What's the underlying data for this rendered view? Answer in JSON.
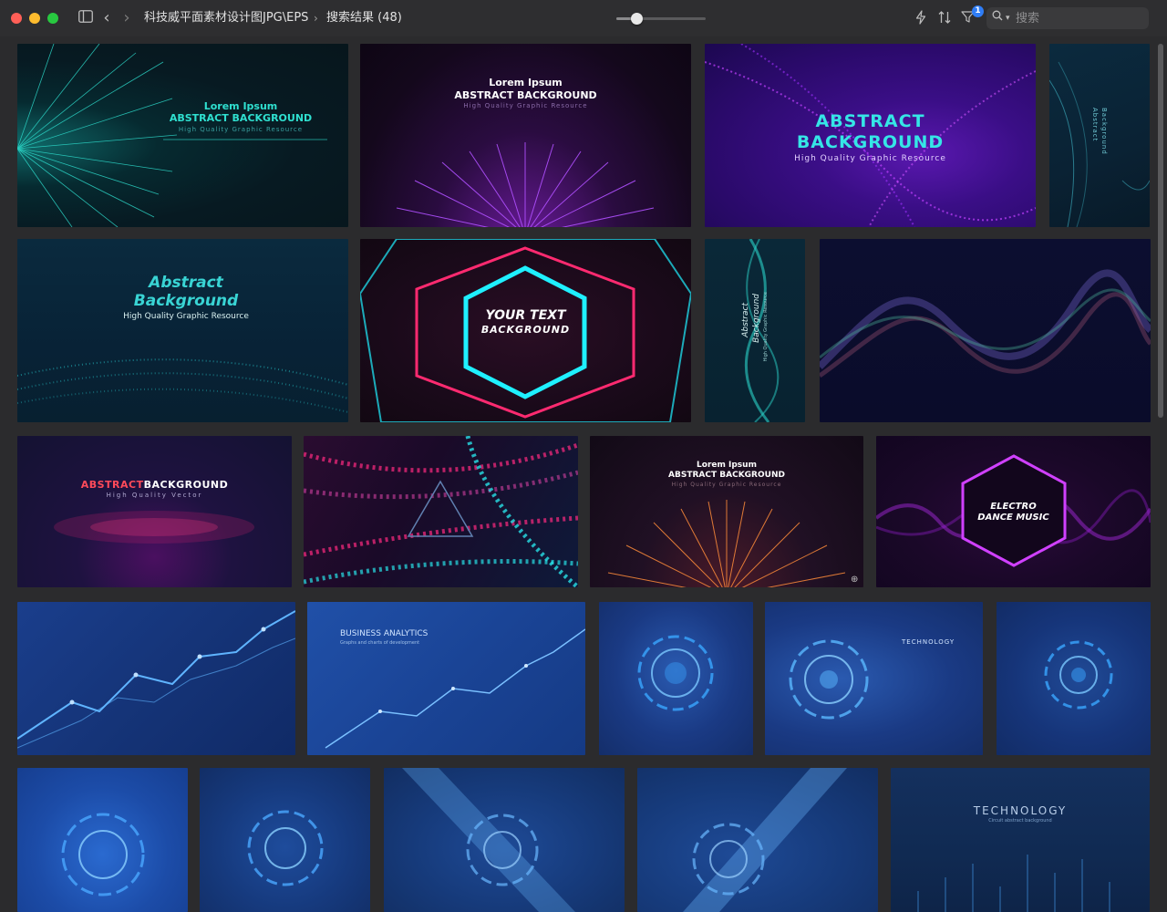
{
  "window": {
    "path_folder": "科技威平面素材设计图JPG\\EPS",
    "path_separator": "›",
    "search_result_label": "搜索结果 (48)",
    "zoom_slider_value": 0.19,
    "filter_badge_count": "1",
    "search_placeholder": "搜索"
  },
  "icons": {
    "sidebar": "sidebar-toggle-icon",
    "back": "chevron-left-icon",
    "forward": "chevron-right-icon",
    "quick_action": "bolt-icon",
    "sort": "sort-icon",
    "filter": "filter-icon",
    "search": "magnifier-icon"
  },
  "thumbnails": {
    "t1": {
      "title": "Lorem Ipsum",
      "title2": "ABSTRACT BACKGROUND",
      "sub": "High Quality Graphic Resource",
      "accent": "#2fe0d0"
    },
    "t2": {
      "title": "Lorem Ipsum",
      "title2": "ABSTRACT BACKGROUND",
      "sub": "High Quality Graphic Resource",
      "accent": "#a040ff"
    },
    "t3": {
      "title": "ABSTRACT",
      "title2": "BACKGROUND",
      "sub": "High Quality Graphic Resource",
      "accent": "#35e6e6"
    },
    "t4": {
      "title": "Abstract",
      "title2": "Background",
      "accent": "#3fb8c8"
    },
    "t5": {
      "title": "Abstract",
      "title2": "Background",
      "sub": "High Quality Graphic Resource",
      "accent": "#39d4d4"
    },
    "t6": {
      "title": "YOUR TEXT",
      "title2": "BACKGROUND",
      "accent": "#1ff0ff"
    },
    "t7": {
      "title": "Abstract",
      "title2": "Background",
      "sub": "High Quality Graphic Resource",
      "accent": "#2ad2c8"
    },
    "t8": {
      "accent": "#7a6bd6"
    },
    "t9": {
      "title_red": "ABSTRACT",
      "title_white": "BACKGROUND",
      "sub": "High Quality Vector",
      "accent": "#ff4a5a"
    },
    "t10": {
      "accent": "#28e0e6"
    },
    "t11": {
      "title": "Lorem Ipsum",
      "title2": "ABSTRACT BACKGROUND",
      "sub": "High Quality Graphic Resource",
      "accent": "#ff8c3a"
    },
    "t12": {
      "title": "ELECTRO",
      "title2": "DANCE MUSIC",
      "accent": "#d040ff"
    },
    "t13": {
      "accent": "#5fb4ff"
    },
    "t14": {
      "title": "BUSINESS ANALYTICS",
      "sub": "Graphs and charts of development",
      "accent": "#7ac0ff"
    },
    "t15": {
      "accent": "#3aa6ff"
    },
    "t16": {
      "title": "TECHNOLOGY",
      "accent": "#5ab8ff"
    },
    "t17": {
      "accent": "#3aa6ff"
    },
    "t18": {
      "accent": "#4aa8ff"
    },
    "t19": {
      "accent": "#4aa8ff"
    },
    "t20": {
      "accent": "#6ab8ff"
    },
    "t21": {
      "accent": "#6ab8ff"
    },
    "t22": {
      "title": "TECHNOLOGY",
      "sub": "Circuit abstract background",
      "accent": "#4aa8ff"
    }
  }
}
